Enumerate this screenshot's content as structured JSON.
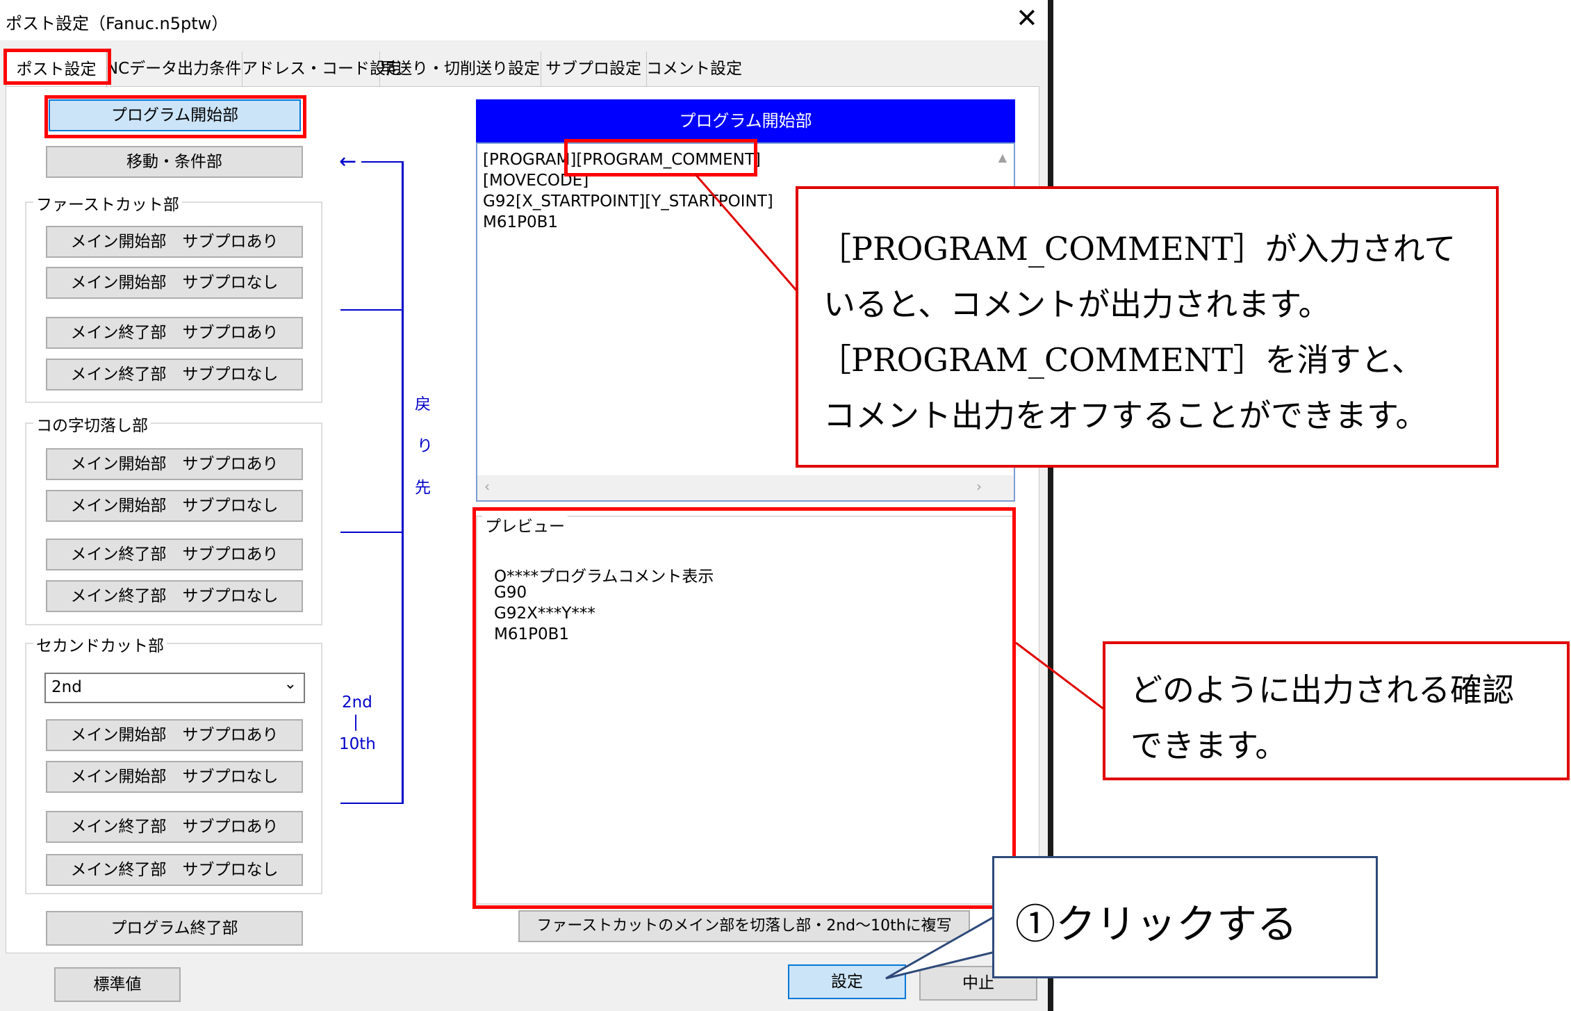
{
  "window": {
    "title": "ポスト設定（Fanuc.n5ptw）",
    "close_glyph": "✕"
  },
  "tabs": [
    {
      "label": "ポスト設定",
      "active": true
    },
    {
      "label": "NCデータ出力条件",
      "active": false
    },
    {
      "label": "アドレス・コード設定",
      "active": false
    },
    {
      "label": "早送り・切削送り設定",
      "active": false
    },
    {
      "label": "サブプロ設定",
      "active": false
    },
    {
      "label": "コメント設定",
      "active": false
    }
  ],
  "left": {
    "program_start": "プログラム開始部",
    "move_condition": "移動・条件部",
    "first_cut": {
      "label": "ファーストカット部",
      "buttons": [
        "メイン開始部　サブプロあり",
        "メイン開始部　サブプロなし",
        "メイン終了部　サブプロあり",
        "メイン終了部　サブプロなし"
      ]
    },
    "u_cut": {
      "label": "コの字切落し部",
      "buttons": [
        "メイン開始部　サブプロあり",
        "メイン開始部　サブプロなし",
        "メイン終了部　サブプロあり",
        "メイン終了部　サブプロなし"
      ]
    },
    "second_cut": {
      "label": "セカンドカット部",
      "select_value": "2nd",
      "buttons": [
        "メイン開始部　サブプロあり",
        "メイン開始部　サブプロなし",
        "メイン終了部　サブプロあり",
        "メイン終了部　サブプロなし"
      ]
    },
    "program_end": "プログラム終了部",
    "return_label": [
      "戻",
      "り",
      "先"
    ],
    "range_label": {
      "top": "2nd",
      "mid": "|",
      "bottom": "10th"
    }
  },
  "code": {
    "header": "プログラム開始部",
    "lines": [
      "[PROGRAM][PROGRAM_COMMENT]",
      "[MOVECODE]",
      "G92[X_STARTPOINT][Y_STARTPOINT]",
      "M61P0B1"
    ]
  },
  "preview": {
    "label": "プレビュー",
    "lines": [
      "O****プログラムコメント表示",
      "G90",
      "G92X***Y***",
      "M61P0B1"
    ]
  },
  "buttons": {
    "copy": "ファーストカットのメイン部を切落し部・2nd～10thに複写",
    "default": "標準値",
    "apply": "設定",
    "cancel": "中止"
  },
  "callouts": {
    "comment_note": [
      "［PROGRAM_COMMENT］が入力されて",
      "いると、コメントが出力されます。",
      "［PROGRAM_COMMENT］を消すと、",
      "コメント出力をオフすることができます。"
    ],
    "preview_note": [
      "どのように出力される確認",
      "できます。"
    ],
    "click_note": "①クリックする"
  },
  "colors": {
    "highlight": "#ff0000",
    "header_blue": "#0000ff",
    "link_blue": "#0000cc"
  }
}
